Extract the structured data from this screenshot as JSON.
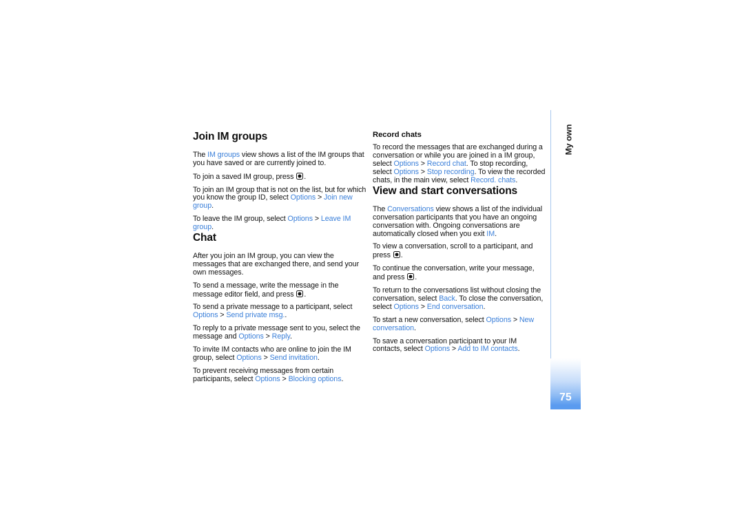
{
  "page": {
    "number": "75",
    "chapter_tab_label": "My own",
    "accent_blue": "#3a7fd9",
    "tab_blue": "#5a9bef",
    "rule_blue": "#a8c7ee",
    "background": "#ffffff",
    "text_color": "#111111"
  },
  "left_column": {
    "heading_1": "Join IM groups",
    "paragraphs_1": [
      {
        "id": "p-im-groups-view",
        "runs": [
          {
            "text": "The ",
            "style": "plain"
          },
          {
            "text": "IM groups",
            "style": "link"
          },
          {
            "text": " view shows a list of the IM groups that you have saved or are currently joined to.",
            "style": "plain"
          }
        ]
      },
      {
        "id": "p-join-saved",
        "runs": [
          {
            "text": "To join a saved IM group, press ",
            "style": "plain"
          },
          {
            "text": "",
            "style": "selectkey"
          },
          {
            "text": ".",
            "style": "plain"
          }
        ]
      },
      {
        "id": "p-join-new",
        "runs": [
          {
            "text": "To join an IM group that is not on the list, but for which you know the group ID, select ",
            "style": "plain"
          },
          {
            "text": "Options",
            "style": "link"
          },
          {
            "text": " > ",
            "style": "sep"
          },
          {
            "text": "Join new group",
            "style": "link"
          },
          {
            "text": ".",
            "style": "plain"
          }
        ]
      },
      {
        "id": "p-leave-group",
        "runs": [
          {
            "text": "To leave the IM group, select ",
            "style": "plain"
          },
          {
            "text": "Options",
            "style": "link"
          },
          {
            "text": " > ",
            "style": "sep"
          },
          {
            "text": "Leave IM group",
            "style": "link"
          },
          {
            "text": ".",
            "style": "plain"
          }
        ]
      }
    ],
    "heading_2": "Chat",
    "paragraphs_2": [
      {
        "id": "p-after-join",
        "runs": [
          {
            "text": "After you join an IM group, you can view the messages that are exchanged there, and send your own messages.",
            "style": "plain"
          }
        ]
      },
      {
        "id": "p-send-message",
        "runs": [
          {
            "text": "To send a message, write the message in the message editor field, and press ",
            "style": "plain"
          },
          {
            "text": "",
            "style": "selectkey"
          },
          {
            "text": ".",
            "style": "plain"
          }
        ]
      },
      {
        "id": "p-send-private",
        "runs": [
          {
            "text": "To send a private message to a participant, select ",
            "style": "plain"
          },
          {
            "text": "Options",
            "style": "link"
          },
          {
            "text": " > ",
            "style": "sep"
          },
          {
            "text": "Send private msg.",
            "style": "link"
          },
          {
            "text": ".",
            "style": "plain"
          }
        ]
      },
      {
        "id": "p-reply-private",
        "runs": [
          {
            "text": "To reply to a private message sent to you, select the message and ",
            "style": "plain"
          },
          {
            "text": "Options",
            "style": "link"
          },
          {
            "text": " > ",
            "style": "sep"
          },
          {
            "text": "Reply",
            "style": "link"
          },
          {
            "text": ".",
            "style": "plain"
          }
        ]
      },
      {
        "id": "p-send-invitation",
        "runs": [
          {
            "text": "To invite IM contacts who are online to join the IM group, select ",
            "style": "plain"
          },
          {
            "text": "Options",
            "style": "link"
          },
          {
            "text": " > ",
            "style": "sep"
          },
          {
            "text": "Send invitation",
            "style": "link"
          },
          {
            "text": ".",
            "style": "plain"
          }
        ]
      },
      {
        "id": "p-blocking-options",
        "runs": [
          {
            "text": "To prevent receiving messages from certain participants, select ",
            "style": "plain"
          },
          {
            "text": "Options",
            "style": "link"
          },
          {
            "text": " > ",
            "style": "sep"
          },
          {
            "text": "Blocking options",
            "style": "link"
          },
          {
            "text": ".",
            "style": "plain"
          }
        ]
      }
    ]
  },
  "right_column": {
    "subheading_1": "Record chats",
    "paragraphs_1": [
      {
        "id": "p-record-chat",
        "runs": [
          {
            "text": "To record the messages that are exchanged during a conversation or while you are joined in a IM group, select ",
            "style": "plain"
          },
          {
            "text": "Options",
            "style": "link"
          },
          {
            "text": " > ",
            "style": "sep"
          },
          {
            "text": "Record chat",
            "style": "link"
          },
          {
            "text": ". To stop recording, select ",
            "style": "plain"
          },
          {
            "text": "Options",
            "style": "link"
          },
          {
            "text": " > ",
            "style": "sep"
          },
          {
            "text": "Stop recording",
            "style": "link"
          },
          {
            "text": ". To view the recorded chats, in the main view, select ",
            "style": "plain"
          },
          {
            "text": "Record. chats",
            "style": "link"
          },
          {
            "text": ".",
            "style": "plain"
          }
        ]
      }
    ],
    "heading_2": "View and start conversations",
    "paragraphs_2": [
      {
        "id": "p-conversations-view",
        "runs": [
          {
            "text": "The ",
            "style": "plain"
          },
          {
            "text": "Conversations",
            "style": "link"
          },
          {
            "text": " view shows a list of the individual conversation participants that you have an ongoing conversation with. Ongoing conversations are automatically closed when you exit ",
            "style": "plain"
          },
          {
            "text": "IM",
            "style": "link"
          },
          {
            "text": ".",
            "style": "plain"
          }
        ]
      },
      {
        "id": "p-view-conversation",
        "runs": [
          {
            "text": "To view a conversation, scroll to a participant, and press ",
            "style": "plain"
          },
          {
            "text": "",
            "style": "selectkey"
          },
          {
            "text": ".",
            "style": "plain"
          }
        ]
      },
      {
        "id": "p-continue-conversation",
        "runs": [
          {
            "text": "To continue the conversation, write your message, and press ",
            "style": "plain"
          },
          {
            "text": "",
            "style": "selectkey"
          },
          {
            "text": ".",
            "style": "plain"
          }
        ]
      },
      {
        "id": "p-end-conversation",
        "runs": [
          {
            "text": "To return to the conversations list without closing the conversation, select ",
            "style": "plain"
          },
          {
            "text": "Back",
            "style": "link"
          },
          {
            "text": ". To close the conversation, select ",
            "style": "plain"
          },
          {
            "text": "Options",
            "style": "link"
          },
          {
            "text": " > ",
            "style": "sep"
          },
          {
            "text": "End conversation",
            "style": "link"
          },
          {
            "text": ".",
            "style": "plain"
          }
        ]
      },
      {
        "id": "p-new-conversation",
        "runs": [
          {
            "text": "To start a new conversation, select ",
            "style": "plain"
          },
          {
            "text": "Options",
            "style": "link"
          },
          {
            "text": " > ",
            "style": "sep"
          },
          {
            "text": "New conversation",
            "style": "link"
          },
          {
            "text": ".",
            "style": "plain"
          }
        ]
      },
      {
        "id": "p-add-to-contacts",
        "runs": [
          {
            "text": "To save a conversation participant to your IM contacts, select ",
            "style": "plain"
          },
          {
            "text": "Options",
            "style": "link"
          },
          {
            "text": " > ",
            "style": "sep"
          },
          {
            "text": "Add to IM contacts",
            "style": "link"
          },
          {
            "text": ".",
            "style": "plain"
          }
        ]
      }
    ]
  }
}
